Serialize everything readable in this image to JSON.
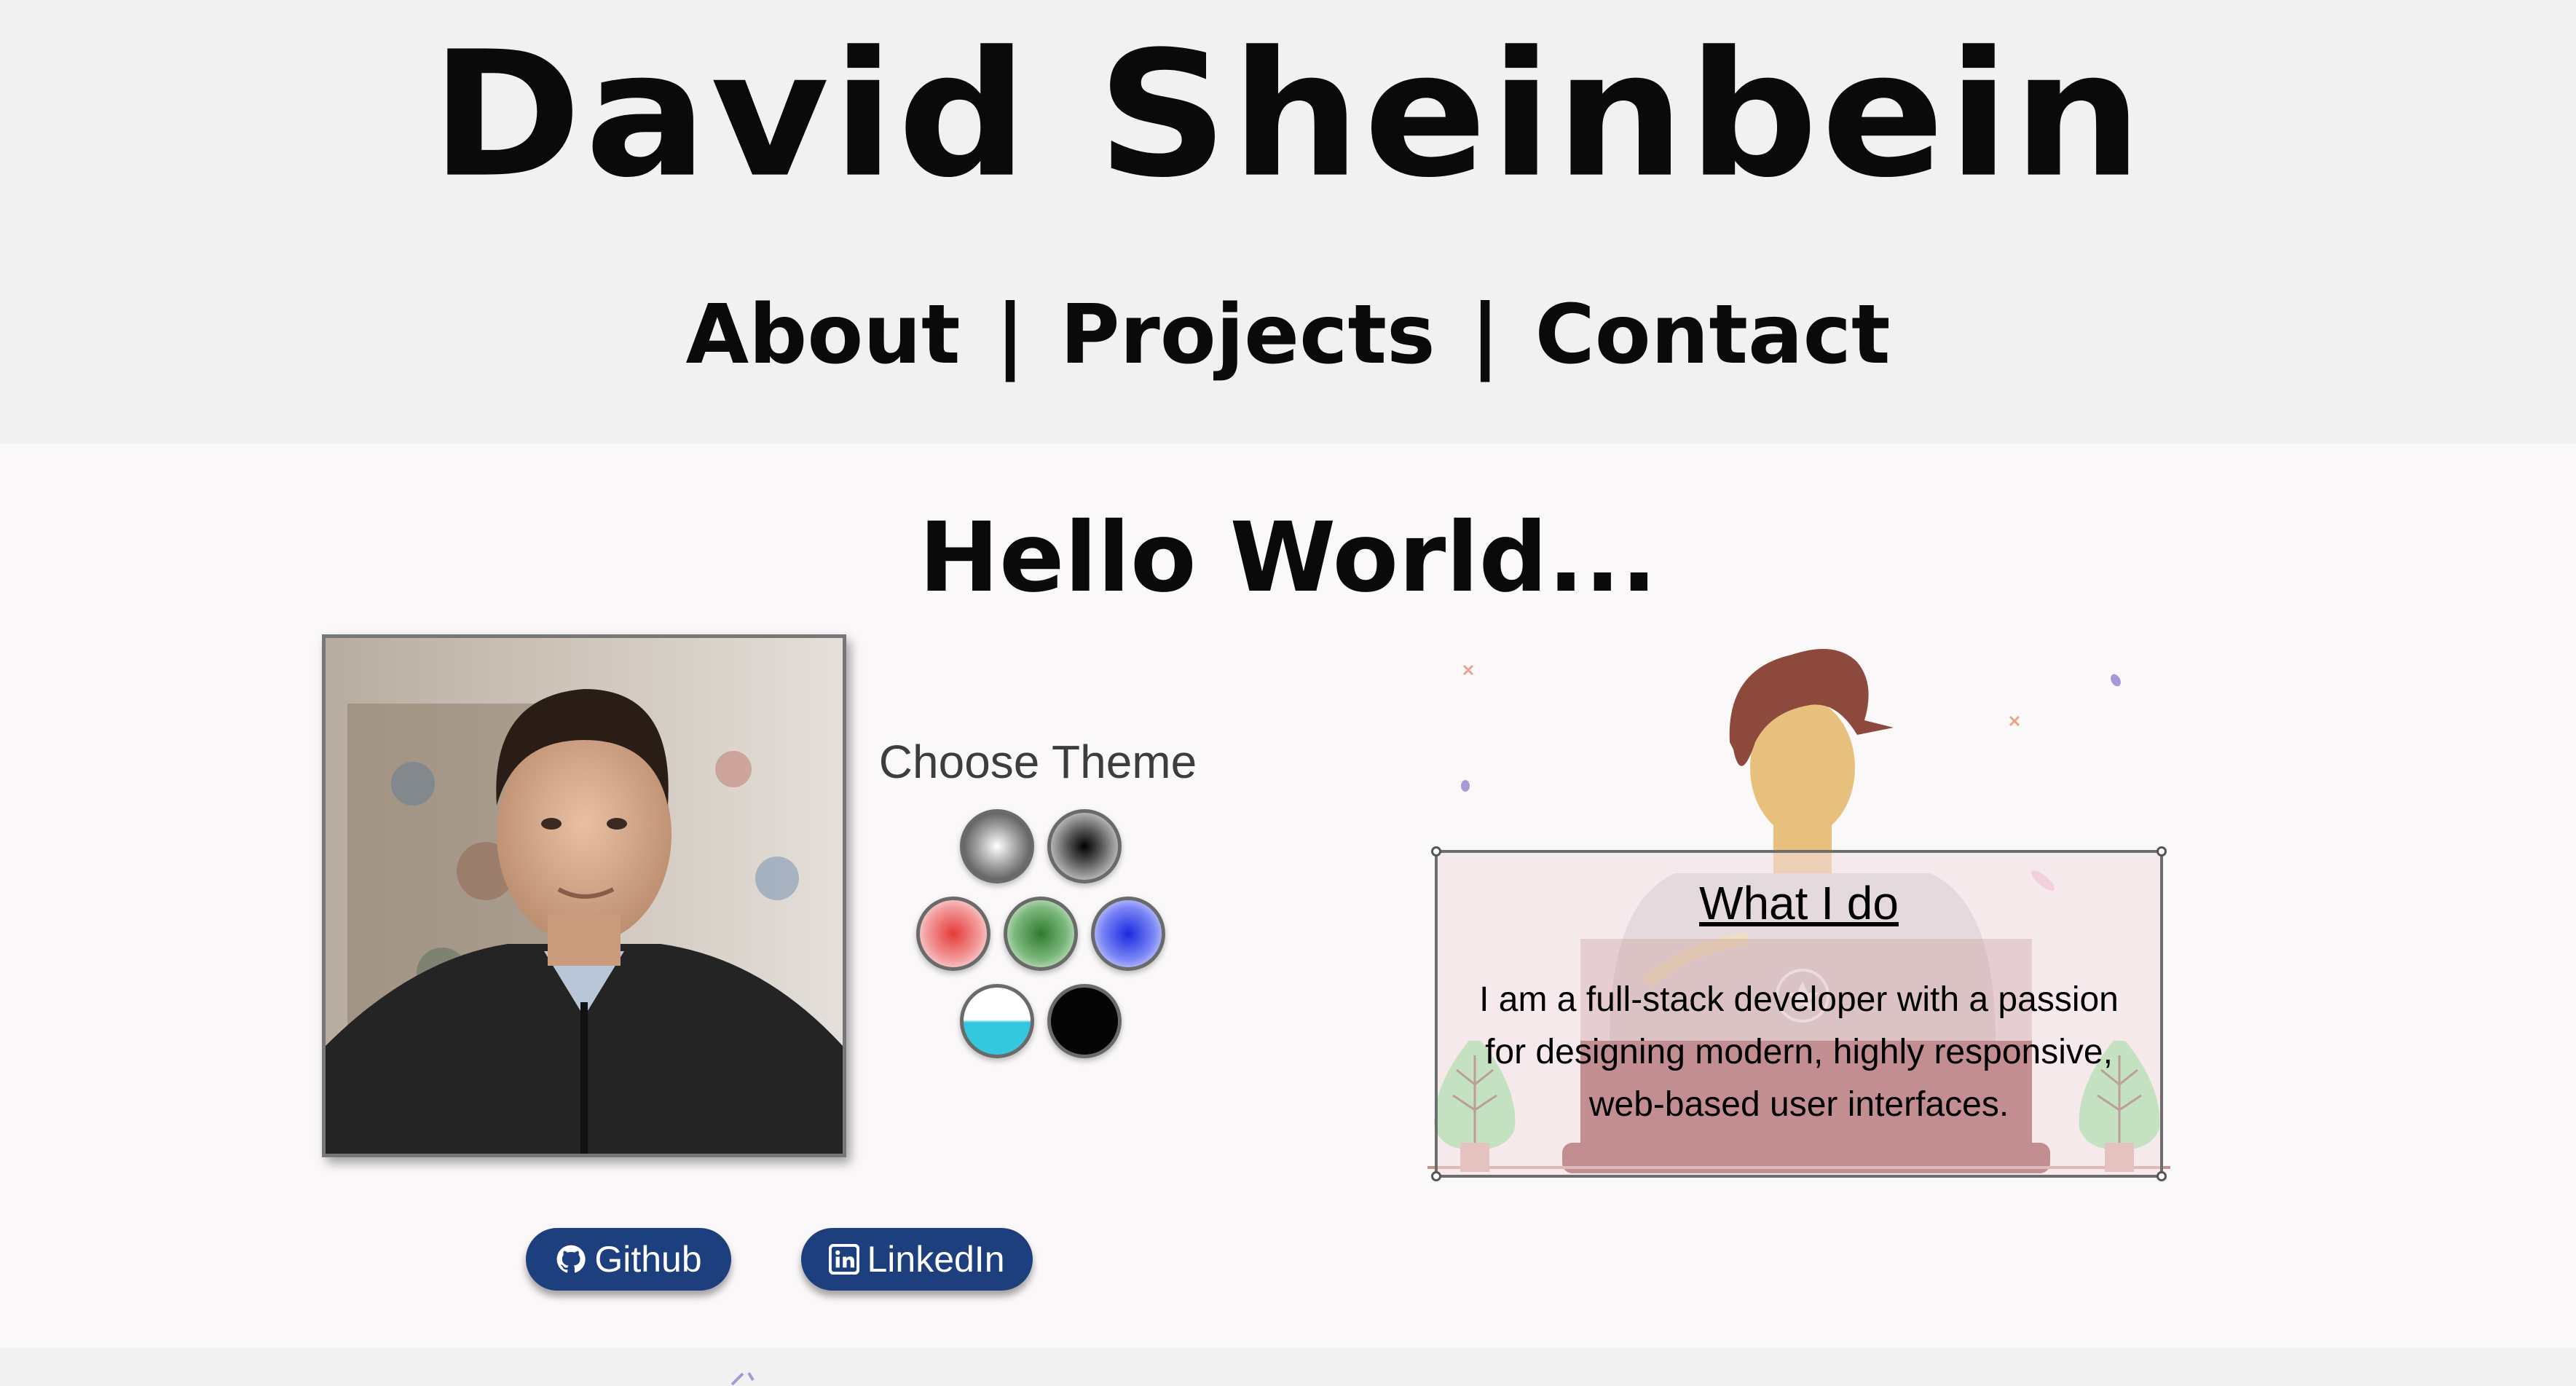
{
  "header": {
    "title": "David Sheinbein",
    "nav": [
      {
        "label": "About"
      },
      {
        "label": "Projects"
      },
      {
        "label": "Contact"
      }
    ],
    "separator": "|"
  },
  "main": {
    "greeting": "Hello World...",
    "theme": {
      "title": "Choose Theme",
      "swatches": [
        {
          "name": "light-gray",
          "color": "#9a9a9a"
        },
        {
          "name": "dark-gray",
          "color": "#3a3a3a"
        },
        {
          "name": "red",
          "color": "#e63a3a"
        },
        {
          "name": "green",
          "color": "#3d8b3d"
        },
        {
          "name": "blue",
          "color": "#2a3cf0"
        },
        {
          "name": "cyan",
          "color": "#33c8dd"
        },
        {
          "name": "black",
          "color": "#050505"
        }
      ]
    },
    "links": {
      "github": "Github",
      "linkedin": "LinkedIn"
    },
    "what_i_do": {
      "title": "What I do",
      "body": "I am a full-stack developer with a passion for designing modern, highly responsive, web-based user interfaces."
    }
  },
  "colors": {
    "header_bg": "#f1f1f1",
    "page_bg": "#fbf8f9",
    "button_bg": "#1e3f7d",
    "desk": "#8b2f2f"
  }
}
